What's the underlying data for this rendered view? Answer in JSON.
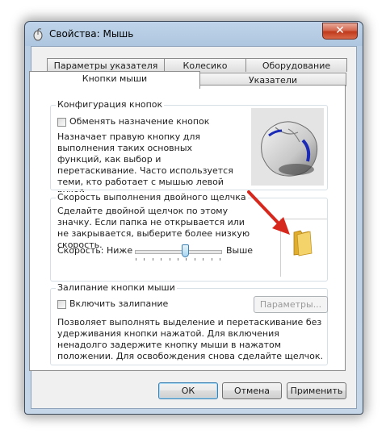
{
  "window": {
    "title": "Свойства: Мышь",
    "close_label": "✕"
  },
  "tabs": [
    {
      "label": "Параметры указателя"
    },
    {
      "label": "Колесико"
    },
    {
      "label": "Оборудование"
    },
    {
      "label": "Кнопки мыши",
      "active": true
    },
    {
      "label": "Указатели"
    }
  ],
  "button_config": {
    "title": "Конфигурация кнопок",
    "checkbox_label": "Обменять назначение кнопок",
    "checked": false,
    "description": "Назначает правую кнопку для выполнения таких основных функций, как выбор и перетаскивание. Часто используется теми, кто работает с мышью левой рукой."
  },
  "double_click": {
    "title": "Скорость выполнения двойного щелчка",
    "description": "Сделайте двойной щелчок по этому значку. Если папка не открывается или не закрывается, выберите более низкую скорость.",
    "speed_label": "Скорость:",
    "low_label": "Ниже",
    "high_label": "Выше",
    "speed_level": 0.6
  },
  "click_lock": {
    "title": "Залипание кнопки мыши",
    "checkbox_label": "Включить залипание",
    "checked": false,
    "settings_button": "Параметры...",
    "description": "Позволяет выполнять выделение и перетаскивание без удерживания кнопки нажатой. Для включения ненадолго задержите кнопку мыши в нажатом положении. Для освобождения снова сделайте щелчок."
  },
  "footer": {
    "ok": "ОК",
    "cancel": "Отмена",
    "apply": "Применить"
  },
  "colors": {
    "arrow": "#d7281e",
    "folder": "#f2c94c",
    "focus_border": "#3c7fb1"
  }
}
